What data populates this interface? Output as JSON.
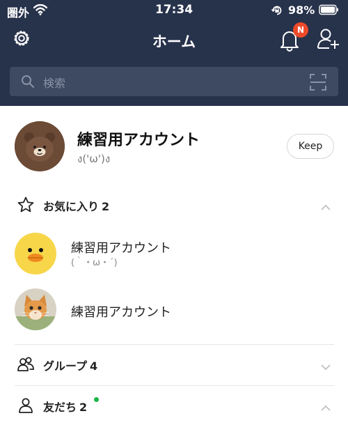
{
  "status_bar": {
    "carrier": "圏外",
    "time": "17:34",
    "battery": "98%"
  },
  "nav": {
    "title": "ホーム",
    "notification_badge": "N"
  },
  "search": {
    "placeholder": "検索"
  },
  "profile": {
    "name": "練習用アカウント",
    "status": "ง('ω')ง",
    "keep_label": "Keep"
  },
  "sections": {
    "favorites": {
      "label": "お気に入り",
      "count": "2"
    },
    "groups": {
      "label": "グループ",
      "count": "4"
    },
    "friends": {
      "label": "友だち",
      "count": "2"
    }
  },
  "favorites": [
    {
      "name": "練習用アカウント",
      "status": "(｀・ω・´)",
      "avatar": "yellow-chick"
    },
    {
      "name": "練習用アカウント",
      "status": "",
      "avatar": "kitten-photo"
    }
  ],
  "colors": {
    "header_bg": "#27324b",
    "search_bg": "#3e4962",
    "badge": "#ee4a2a",
    "online_dot": "#1db54a"
  }
}
